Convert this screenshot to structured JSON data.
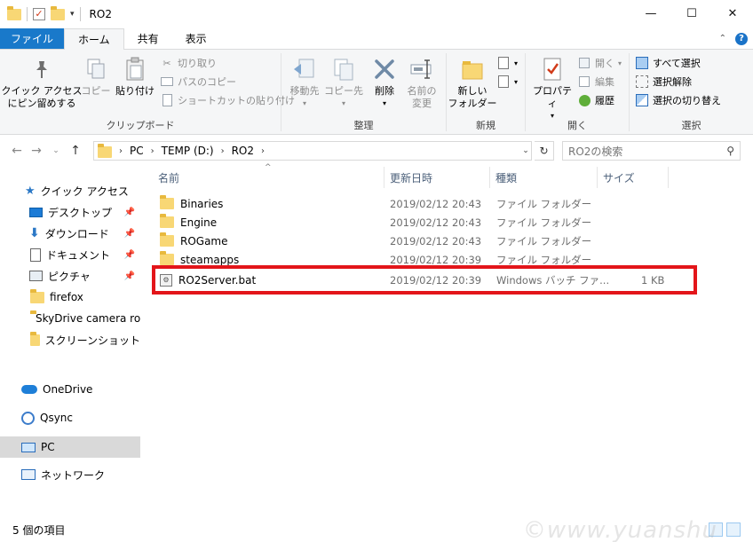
{
  "window": {
    "title": "RO2"
  },
  "tabs": [
    {
      "label": "ファイル"
    },
    {
      "label": "ホーム"
    },
    {
      "label": "共有"
    },
    {
      "label": "表示"
    }
  ],
  "ribbon": {
    "clipboard": {
      "label": "クリップボード",
      "pin": "クイック アクセス\nにピン留めする",
      "copy": "コピー",
      "paste": "貼り付け",
      "cut": "切り取り",
      "copy_path": "パスのコピー",
      "paste_shortcut": "ショートカットの貼り付け"
    },
    "organize": {
      "label": "整理",
      "move": "移動先",
      "copy_to": "コピー先",
      "delete": "削除",
      "rename": "名前の\n変更"
    },
    "new": {
      "label": "新規",
      "new_folder": "新しい\nフォルダー"
    },
    "open": {
      "label": "開く",
      "properties": "プロパティ",
      "open": "開く",
      "edit": "編集",
      "history": "履歴"
    },
    "select": {
      "label": "選択",
      "select_all": "すべて選択",
      "select_none": "選択解除",
      "invert": "選択の切り替え"
    }
  },
  "address": {
    "crumbs": [
      "PC",
      "TEMP (D:)",
      "RO2"
    ],
    "search_placeholder": "RO2の検索"
  },
  "nav": {
    "quick_access": "クイック アクセス",
    "items": [
      {
        "label": "デスクトップ",
        "pinned": true
      },
      {
        "label": "ダウンロード",
        "pinned": true
      },
      {
        "label": "ドキュメント",
        "pinned": true
      },
      {
        "label": "ピクチャ",
        "pinned": true
      },
      {
        "label": "firefox",
        "pinned": false
      },
      {
        "label": "SkyDrive camera rol",
        "pinned": false
      },
      {
        "label": "スクリーンショット",
        "pinned": false
      }
    ],
    "onedrive": "OneDrive",
    "qsync": "Qsync",
    "pc": "PC",
    "network": "ネットワーク"
  },
  "columns": {
    "name": "名前",
    "date": "更新日時",
    "type": "種類",
    "size": "サイズ"
  },
  "files": [
    {
      "name": "Binaries",
      "date": "2019/02/12 20:43",
      "type": "ファイル フォルダー",
      "size": ""
    },
    {
      "name": "Engine",
      "date": "2019/02/12 20:43",
      "type": "ファイル フォルダー",
      "size": ""
    },
    {
      "name": "ROGame",
      "date": "2019/02/12 20:43",
      "type": "ファイル フォルダー",
      "size": ""
    },
    {
      "name": "steamapps",
      "date": "2019/02/12 20:39",
      "type": "ファイル フォルダー",
      "size": ""
    },
    {
      "name": "RO2Server.bat",
      "date": "2019/02/12 20:39",
      "type": "Windows バッチ ファ...",
      "size": "1 KB"
    }
  ],
  "status": {
    "count": "5 個の項目"
  },
  "watermark": "©www.yuanshu"
}
